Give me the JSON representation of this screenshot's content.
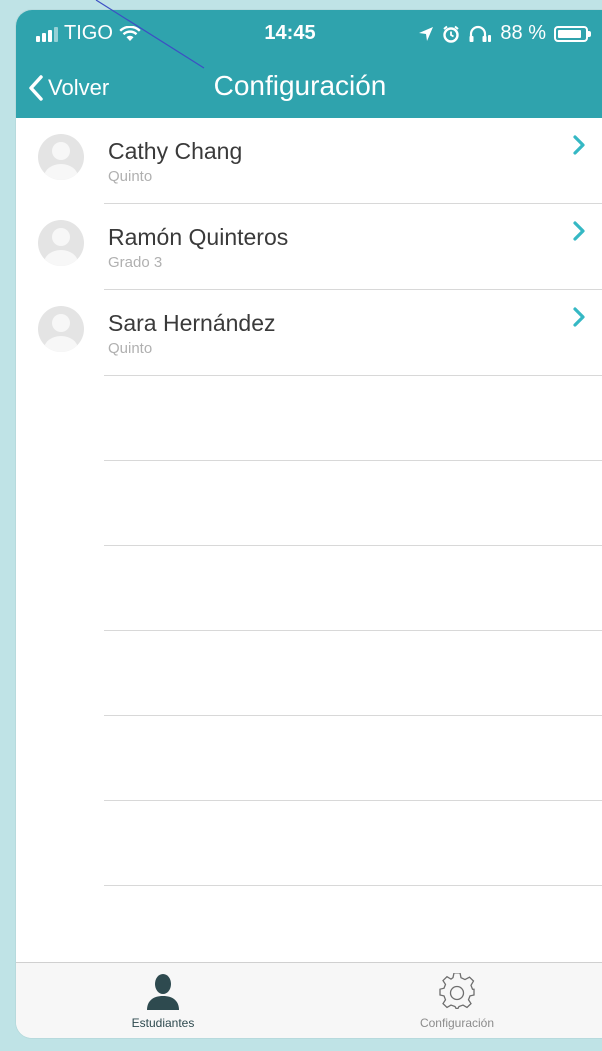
{
  "status_bar": {
    "carrier": "TIGO",
    "time": "14:45",
    "battery": "88 %",
    "battery_level": 0.88
  },
  "nav": {
    "back_label": "Volver",
    "title": "Configuración"
  },
  "students": [
    {
      "name": "Cathy Chang",
      "grade": "Quinto"
    },
    {
      "name": "Ramón Quinteros",
      "grade": "Grado 3"
    },
    {
      "name": "Sara Hernández",
      "grade": "Quinto"
    }
  ],
  "tabs": [
    {
      "label": "Estudiantes",
      "icon": "person-icon",
      "active": true
    },
    {
      "label": "Configuración",
      "icon": "gear-icon",
      "active": false
    }
  ],
  "colors": {
    "header": "#2fa3ad",
    "accent": "#35b8c4",
    "background": "#bfe3e6"
  }
}
